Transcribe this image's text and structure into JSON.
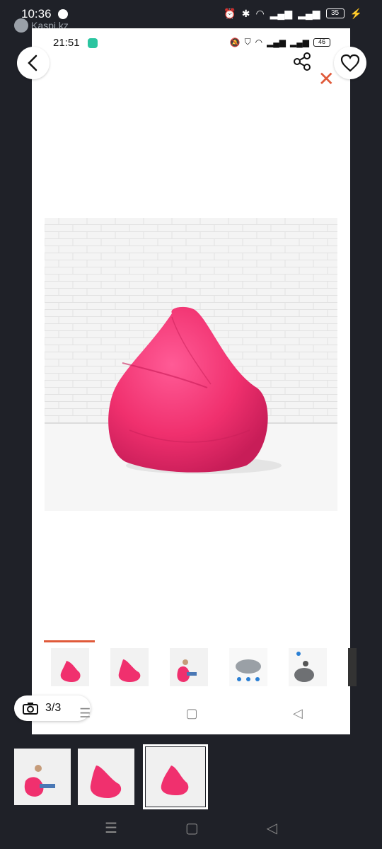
{
  "outer_status": {
    "time": "10:36",
    "battery": "35",
    "watermark": "Kaspi.kz"
  },
  "inner_status": {
    "time": "21:51",
    "battery": "46"
  },
  "gallery": {
    "counter": "3/3",
    "thumbnails": [
      "pink-beanbag",
      "pink-beanbag-side",
      "girl-on-beanbag",
      "grey-beanbag-info",
      "person-on-grey-beanbag"
    ]
  },
  "bottom_thumbnails": [
    "girl-on-pink-beanbag",
    "pink-beanbag-side",
    "pink-beanbag-front"
  ],
  "icons": {
    "back": "chevron-left-icon",
    "share": "share-icon",
    "favorite": "heart-icon",
    "close": "close-icon",
    "camera": "camera-icon"
  },
  "colors": {
    "accent": "#e05a3a",
    "product": "#f0306e",
    "background": "#1f2128"
  },
  "nav": {
    "menu": "☰",
    "home": "▢",
    "back": "◁"
  }
}
